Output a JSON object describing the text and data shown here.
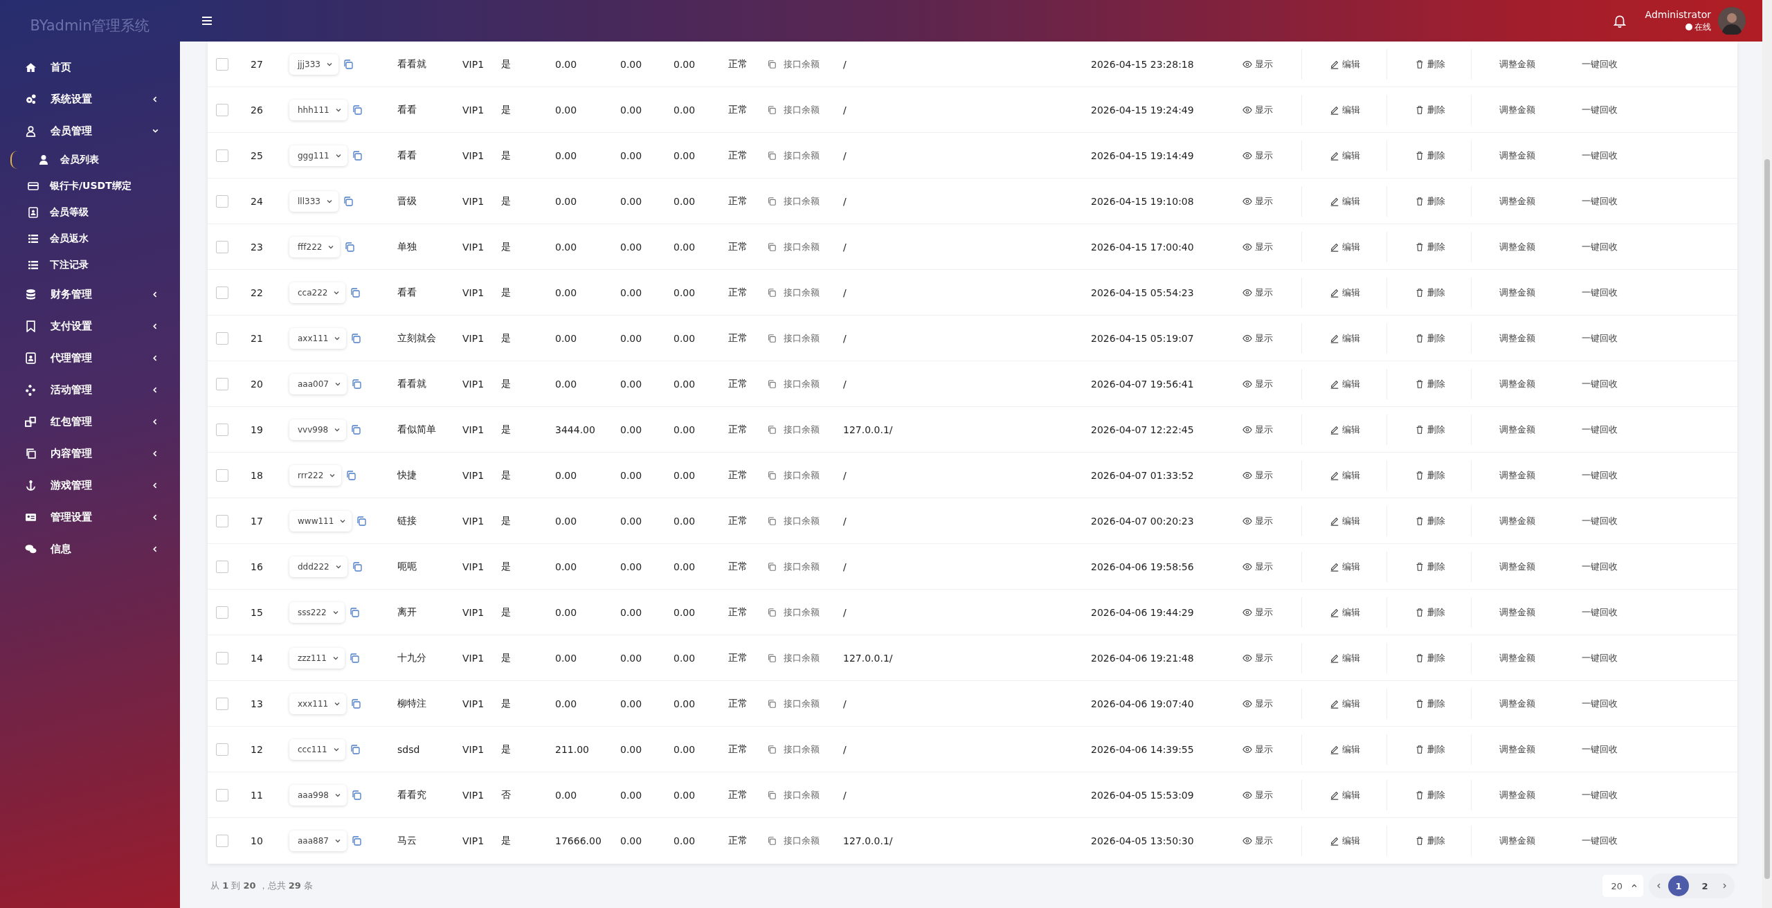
{
  "sidebar": {
    "title": "BYadmin管理系统",
    "items": [
      {
        "label": "首页",
        "has_arrow": false
      },
      {
        "label": "系统设置",
        "has_arrow": true,
        "expanded": false
      },
      {
        "label": "会员管理",
        "has_arrow": true,
        "expanded": true,
        "children": [
          {
            "label": "会员列表",
            "selected": true
          },
          {
            "label": "银行卡/USDT绑定",
            "selected": false
          },
          {
            "label": "会员等级",
            "selected": false
          },
          {
            "label": "会员返水",
            "selected": false
          },
          {
            "label": "下注记录",
            "selected": false
          }
        ]
      },
      {
        "label": "财务管理",
        "has_arrow": true,
        "expanded": false
      },
      {
        "label": "支付设置",
        "has_arrow": true,
        "expanded": false
      },
      {
        "label": "代理管理",
        "has_arrow": true,
        "expanded": false
      },
      {
        "label": "活动管理",
        "has_arrow": true,
        "expanded": false
      },
      {
        "label": "红包管理",
        "has_arrow": true,
        "expanded": false
      },
      {
        "label": "内容管理",
        "has_arrow": true,
        "expanded": false
      },
      {
        "label": "游戏管理",
        "has_arrow": true,
        "expanded": false
      },
      {
        "label": "管理设置",
        "has_arrow": true,
        "expanded": false
      },
      {
        "label": "信息",
        "has_arrow": true,
        "expanded": false
      }
    ]
  },
  "header": {
    "user_name": "Administrator",
    "status": "在线",
    "online": true
  },
  "table": {
    "rows": [
      {
        "checked": false,
        "id": "27",
        "username": "jjj333",
        "nickname": "看看就",
        "level": "VIP1",
        "column_5": "是",
        "column_6": "0.00",
        "column_7": "0.00",
        "column_8": "0.00",
        "status": "正常",
        "balance_link": "接口余额",
        "ip": "/",
        "time": "2026-04-15 23:28:18",
        "actions": [
          "显示",
          "编辑",
          "删除",
          "调整金额",
          "一键回收"
        ]
      },
      {
        "checked": false,
        "id": "26",
        "username": "hhh111",
        "nickname": "看看",
        "level": "VIP1",
        "column_5": "是",
        "column_6": "0.00",
        "column_7": "0.00",
        "column_8": "0.00",
        "status": "正常",
        "balance_link": "接口余额",
        "ip": "/",
        "time": "2026-04-15 19:24:49",
        "actions": [
          "显示",
          "编辑",
          "删除",
          "调整金额",
          "一键回收"
        ]
      },
      {
        "checked": false,
        "id": "25",
        "username": "ggg111",
        "nickname": "看看",
        "level": "VIP1",
        "column_5": "是",
        "column_6": "0.00",
        "column_7": "0.00",
        "column_8": "0.00",
        "status": "正常",
        "balance_link": "接口余额",
        "ip": "/",
        "time": "2026-04-15 19:14:49",
        "actions": [
          "显示",
          "编辑",
          "删除",
          "调整金额",
          "一键回收"
        ]
      },
      {
        "checked": false,
        "id": "24",
        "username": "lll333",
        "nickname": "晋级",
        "level": "VIP1",
        "column_5": "是",
        "column_6": "0.00",
        "column_7": "0.00",
        "column_8": "0.00",
        "status": "正常",
        "balance_link": "接口余额",
        "ip": "/",
        "time": "2026-04-15 19:10:08",
        "actions": [
          "显示",
          "编辑",
          "删除",
          "调整金额",
          "一键回收"
        ]
      },
      {
        "checked": false,
        "id": "23",
        "username": "fff222",
        "nickname": "单独",
        "level": "VIP1",
        "column_5": "是",
        "column_6": "0.00",
        "column_7": "0.00",
        "column_8": "0.00",
        "status": "正常",
        "balance_link": "接口余额",
        "ip": "/",
        "time": "2026-04-15 17:00:40",
        "actions": [
          "显示",
          "编辑",
          "删除",
          "调整金额",
          "一键回收"
        ]
      },
      {
        "checked": false,
        "id": "22",
        "username": "cca222",
        "nickname": "看看",
        "level": "VIP1",
        "column_5": "是",
        "column_6": "0.00",
        "column_7": "0.00",
        "column_8": "0.00",
        "status": "正常",
        "balance_link": "接口余额",
        "ip": "/",
        "time": "2026-04-15 05:54:23",
        "actions": [
          "显示",
          "编辑",
          "删除",
          "调整金额",
          "一键回收"
        ]
      },
      {
        "checked": false,
        "id": "21",
        "username": "axx111",
        "nickname": "立刻就会",
        "level": "VIP1",
        "column_5": "是",
        "column_6": "0.00",
        "column_7": "0.00",
        "column_8": "0.00",
        "status": "正常",
        "balance_link": "接口余额",
        "ip": "/",
        "time": "2026-04-15 05:19:07",
        "actions": [
          "显示",
          "编辑",
          "删除",
          "调整金额",
          "一键回收"
        ]
      },
      {
        "checked": false,
        "id": "20",
        "username": "aaa007",
        "nickname": "看看就",
        "level": "VIP1",
        "column_5": "是",
        "column_6": "0.00",
        "column_7": "0.00",
        "column_8": "0.00",
        "status": "正常",
        "balance_link": "接口余额",
        "ip": "/",
        "time": "2026-04-07 19:56:41",
        "actions": [
          "显示",
          "编辑",
          "删除",
          "调整金额",
          "一键回收"
        ]
      },
      {
        "checked": false,
        "id": "19",
        "username": "vvv998",
        "nickname": "看似简单",
        "level": "VIP1",
        "column_5": "是",
        "column_6": "3444.00",
        "column_7": "0.00",
        "column_8": "0.00",
        "status": "正常",
        "balance_link": "接口余额",
        "ip": "127.0.0.1/",
        "time": "2026-04-07 12:22:45",
        "actions": [
          "显示",
          "编辑",
          "删除",
          "调整金额",
          "一键回收"
        ]
      },
      {
        "checked": false,
        "id": "18",
        "username": "rrr222",
        "nickname": "快捷",
        "level": "VIP1",
        "column_5": "是",
        "column_6": "0.00",
        "column_7": "0.00",
        "column_8": "0.00",
        "status": "正常",
        "balance_link": "接口余额",
        "ip": "/",
        "time": "2026-04-07 01:33:52",
        "actions": [
          "显示",
          "编辑",
          "删除",
          "调整金额",
          "一键回收"
        ]
      },
      {
        "checked": false,
        "id": "17",
        "username": "www111",
        "nickname": "链接",
        "level": "VIP1",
        "column_5": "是",
        "column_6": "0.00",
        "column_7": "0.00",
        "column_8": "0.00",
        "status": "正常",
        "balance_link": "接口余额",
        "ip": "/",
        "time": "2026-04-07 00:20:23",
        "actions": [
          "显示",
          "编辑",
          "删除",
          "调整金额",
          "一键回收"
        ]
      },
      {
        "checked": false,
        "id": "16",
        "username": "ddd222",
        "nickname": "呃呃",
        "level": "VIP1",
        "column_5": "是",
        "column_6": "0.00",
        "column_7": "0.00",
        "column_8": "0.00",
        "status": "正常",
        "balance_link": "接口余额",
        "ip": "/",
        "time": "2026-04-06 19:58:56",
        "actions": [
          "显示",
          "编辑",
          "删除",
          "调整金额",
          "一键回收"
        ]
      },
      {
        "checked": false,
        "id": "15",
        "username": "sss222",
        "nickname": "离开",
        "level": "VIP1",
        "column_5": "是",
        "column_6": "0.00",
        "column_7": "0.00",
        "column_8": "0.00",
        "status": "正常",
        "balance_link": "接口余额",
        "ip": "/",
        "time": "2026-04-06 19:44:29",
        "actions": [
          "显示",
          "编辑",
          "删除",
          "调整金额",
          "一键回收"
        ]
      },
      {
        "checked": false,
        "id": "14",
        "username": "zzz111",
        "nickname": "十九分",
        "level": "VIP1",
        "column_5": "是",
        "column_6": "0.00",
        "column_7": "0.00",
        "column_8": "0.00",
        "status": "正常",
        "balance_link": "接口余额",
        "ip": "127.0.0.1/",
        "time": "2026-04-06 19:21:48",
        "actions": [
          "显示",
          "编辑",
          "删除",
          "调整金额",
          "一键回收"
        ]
      },
      {
        "checked": false,
        "id": "13",
        "username": "xxx111",
        "nickname": "柳特注",
        "level": "VIP1",
        "column_5": "是",
        "column_6": "0.00",
        "column_7": "0.00",
        "column_8": "0.00",
        "status": "正常",
        "balance_link": "接口余额",
        "ip": "/",
        "time": "2026-04-06 19:07:40",
        "actions": [
          "显示",
          "编辑",
          "删除",
          "调整金额",
          "一键回收"
        ]
      },
      {
        "checked": false,
        "id": "12",
        "username": "ccc111",
        "nickname": "sdsd",
        "level": "VIP1",
        "column_5": "是",
        "column_6": "211.00",
        "column_7": "0.00",
        "column_8": "0.00",
        "status": "正常",
        "balance_link": "接口余额",
        "ip": "/",
        "time": "2026-04-06 14:39:55",
        "actions": [
          "显示",
          "编辑",
          "删除",
          "调整金额",
          "一键回收"
        ]
      },
      {
        "checked": false,
        "id": "11",
        "username": "aaa998",
        "nickname": "看看究",
        "level": "VIP1",
        "column_5": "否",
        "column_6": "0.00",
        "column_7": "0.00",
        "column_8": "0.00",
        "status": "正常",
        "balance_link": "接口余额",
        "ip": "/",
        "time": "2026-04-05 15:53:09",
        "actions": [
          "显示",
          "编辑",
          "删除",
          "调整金额",
          "一键回收"
        ]
      },
      {
        "checked": false,
        "id": "10",
        "username": "aaa887",
        "nickname": "马云",
        "level": "VIP1",
        "column_5": "是",
        "column_6": "17666.00",
        "column_7": "0.00",
        "column_8": "0.00",
        "status": "正常",
        "balance_link": "接口余额",
        "ip": "127.0.0.1/",
        "time": "2026-04-05 13:50:30",
        "actions": [
          "显示",
          "编辑",
          "删除",
          "调整金额",
          "一键回收"
        ]
      }
    ]
  },
  "footer": {
    "summary": "从 **1** 到 **20** ，总共 **29** 条",
    "page_size": "20",
    "pages": [
      {
        "label": "1",
        "selected": true
      },
      {
        "label": "2",
        "selected": false
      }
    ]
  }
}
